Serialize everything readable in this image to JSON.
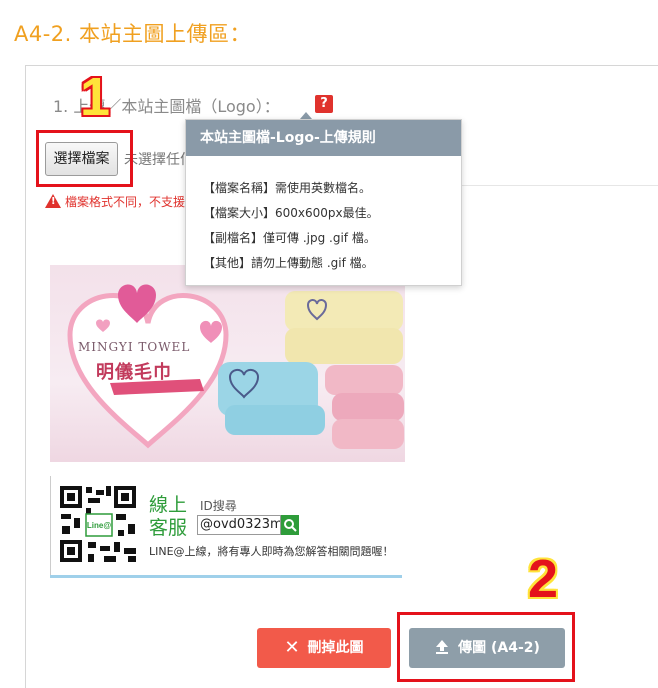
{
  "section": {
    "title": "A4-2. 本站主圖上傳區："
  },
  "field": {
    "label": "1. 上傳／本站主圖檔（Logo）：",
    "help_icon": "help-icon"
  },
  "file_input": {
    "button_label": "選擇檔案",
    "status": "未選擇任何檔案"
  },
  "warning": {
    "text": "檔案格式不同，不支援"
  },
  "tooltip": {
    "title": "本站主圖檔-Logo-上傳規則",
    "lines": [
      "【檔案名稱】需使用英數檔名。",
      "【檔案大小】600x600px最佳。",
      "【副檔名】僅可傳 .jpg .gif 檔。",
      "【其他】請勿上傳動態 .gif 檔。"
    ]
  },
  "banner": {
    "brand_en": "MINGYI TOWEL",
    "brand_zh": "明儀毛巾"
  },
  "contact": {
    "title_line1": "線上",
    "title_line2": "客服",
    "id_label": "ID搜尋",
    "id_value": "@ovd0323m",
    "qr_badge": "Line@",
    "note": "LINE@上線，將有專人即時為您解答相關問題喔！"
  },
  "buttons": {
    "delete_label": "刪掉此圖",
    "upload_label": "傳圖 (A4-2)"
  },
  "callouts": {
    "step1": "1",
    "step2": "2"
  },
  "colors": {
    "title_orange": "#f0a020",
    "callout_red": "#e4121b",
    "tooltip_header": "#8a9aa8",
    "delete_red": "#f25a4a",
    "upload_gray": "#8e9ea9",
    "line_green": "#2e9c3a"
  }
}
